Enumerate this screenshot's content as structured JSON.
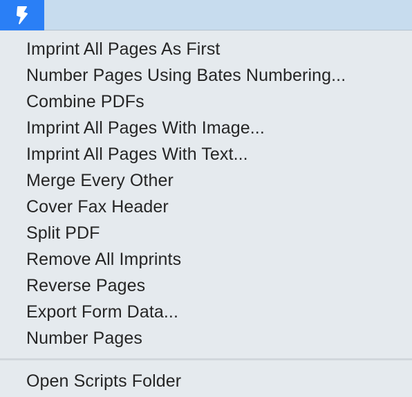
{
  "menubar": {
    "script_menu_icon": "script-s-icon",
    "accent_color": "#2a7ff6"
  },
  "menu": {
    "items": [
      "Imprint All Pages As First",
      "Number Pages Using Bates Numbering...",
      "Combine PDFs",
      "Imprint All Pages With Image...",
      "Imprint All Pages With Text...",
      "Merge Every Other",
      "Cover Fax Header",
      "Split PDF",
      "Remove All Imprints",
      "Reverse Pages",
      "Export Form Data...",
      "Number Pages"
    ],
    "footer_item": "Open Scripts Folder"
  }
}
